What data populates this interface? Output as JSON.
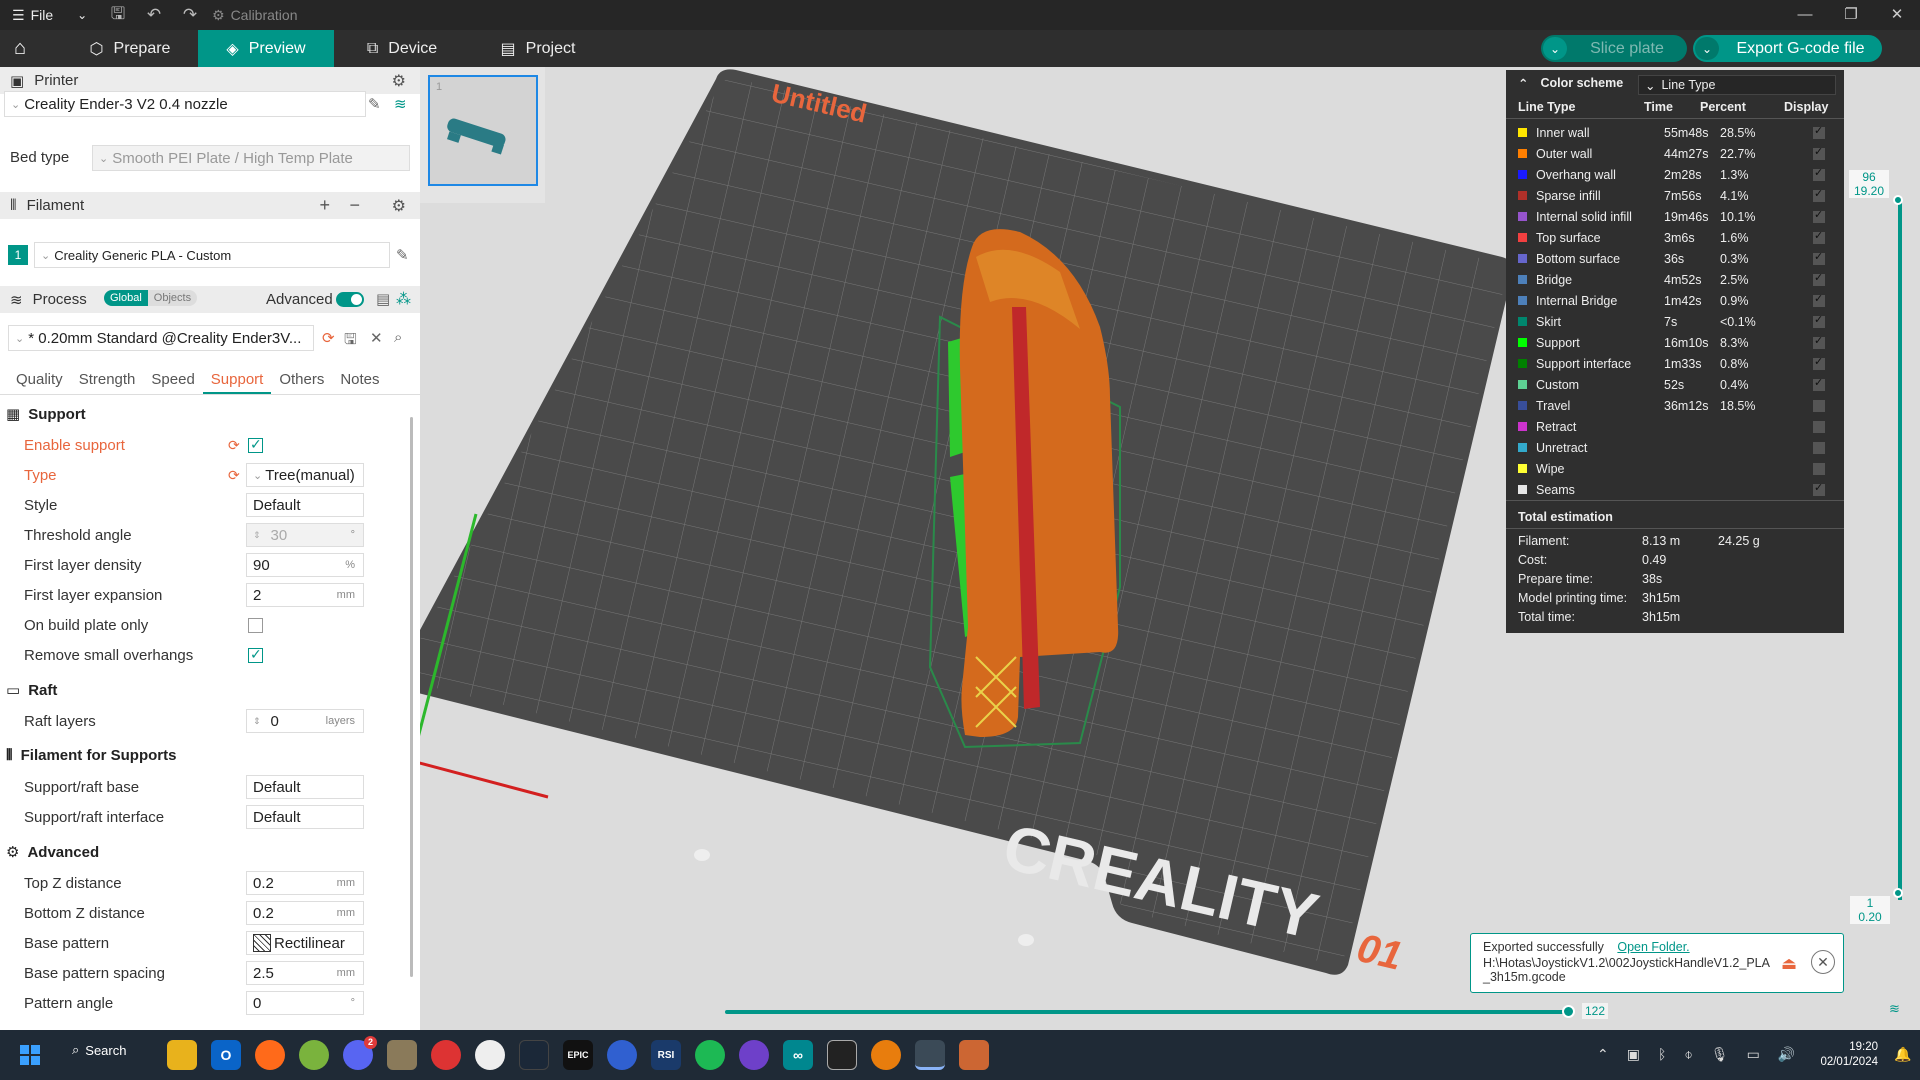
{
  "titlebar": {
    "file_label": "File",
    "doc_title": "Calibration"
  },
  "tabs": {
    "prepare": "Prepare",
    "preview": "Preview",
    "device": "Device",
    "project": "Project",
    "slice_plate": "Slice plate",
    "export_gcode": "Export G-code file"
  },
  "printer": {
    "section_label": "Printer",
    "name": "Creality Ender-3 V2 0.4 nozzle",
    "bed_type_label": "Bed type",
    "bed_type": "Smooth PEI Plate / High Temp Plate"
  },
  "filament": {
    "section_label": "Filament",
    "slot_index": "1",
    "name": "Creality Generic PLA - Custom"
  },
  "process": {
    "section_label": "Process",
    "global_label": "Global",
    "objects_label": "Objects",
    "advanced_label": "Advanced",
    "profile": "* 0.20mm Standard @Creality Ender3V..."
  },
  "subtabs": [
    "Quality",
    "Strength",
    "Speed",
    "Support",
    "Others",
    "Notes"
  ],
  "support_params": {
    "support_title": "Support",
    "enable_support": "Enable support",
    "type_label": "Type",
    "type_value": "Tree(manual)",
    "style_label": "Style",
    "style_value": "Default",
    "threshold_label": "Threshold angle",
    "threshold_value": "30",
    "threshold_unit": "°",
    "first_layer_density_label": "First layer density",
    "first_layer_density_value": "90",
    "first_layer_density_unit": "%",
    "first_layer_expansion_label": "First layer expansion",
    "first_layer_expansion_value": "2",
    "mm": "mm",
    "on_build_plate_label": "On build plate only",
    "remove_small_label": "Remove small overhangs",
    "raft_title": "Raft",
    "raft_layers_label": "Raft layers",
    "raft_layers_value": "0",
    "raft_layers_unit": "layers",
    "filament_supports_title": "Filament for Supports",
    "support_raft_base_label": "Support/raft base",
    "support_raft_base_value": "Default",
    "support_raft_interface_label": "Support/raft interface",
    "support_raft_interface_value": "Default",
    "advanced_title": "Advanced",
    "top_z_label": "Top Z distance",
    "top_z_value": "0.2",
    "bottom_z_label": "Bottom Z distance",
    "bottom_z_value": "0.2",
    "base_pattern_label": "Base pattern",
    "base_pattern_value": "Rectilinear",
    "base_pattern_spacing_label": "Base pattern spacing",
    "base_pattern_spacing_value": "2.5",
    "pattern_angle_label": "Pattern angle",
    "pattern_angle_value": "0",
    "deg": "°"
  },
  "viewport": {
    "plate_name": "Untitled",
    "plate_brand": "CREALITY",
    "plate_number": "01",
    "thumb_index": "1"
  },
  "legend": {
    "color_scheme_label": "Color scheme",
    "color_scheme_value": "Line Type",
    "col_line_type": "Line Type",
    "col_time": "Time",
    "col_percent": "Percent",
    "col_display": "Display",
    "rows": [
      {
        "name": "Inner wall",
        "time": "55m48s",
        "percent": "28.5%",
        "color": "#ffe600",
        "display": true
      },
      {
        "name": "Outer wall",
        "time": "44m27s",
        "percent": "22.7%",
        "color": "#ff7f00",
        "display": true
      },
      {
        "name": "Overhang wall",
        "time": "2m28s",
        "percent": "1.3%",
        "color": "#1a1aff",
        "display": true
      },
      {
        "name": "Sparse infill",
        "time": "7m56s",
        "percent": "4.1%",
        "color": "#b03029",
        "display": true
      },
      {
        "name": "Internal solid infill",
        "time": "19m46s",
        "percent": "10.1%",
        "color": "#9654cc",
        "display": true
      },
      {
        "name": "Top surface",
        "time": "3m6s",
        "percent": "1.6%",
        "color": "#f24040",
        "display": true
      },
      {
        "name": "Bottom surface",
        "time": "36s",
        "percent": "0.3%",
        "color": "#6666cc",
        "display": true
      },
      {
        "name": "Bridge",
        "time": "4m52s",
        "percent": "2.5%",
        "color": "#4d80ba",
        "display": true
      },
      {
        "name": "Internal Bridge",
        "time": "1m42s",
        "percent": "0.9%",
        "color": "#4d80ba",
        "display": true
      },
      {
        "name": "Skirt",
        "time": "7s",
        "percent": "<0.1%",
        "color": "#00876e",
        "display": true
      },
      {
        "name": "Support",
        "time": "16m10s",
        "percent": "8.3%",
        "color": "#00ff00",
        "display": true
      },
      {
        "name": "Support interface",
        "time": "1m33s",
        "percent": "0.8%",
        "color": "#008000",
        "display": true
      },
      {
        "name": "Custom",
        "time": "52s",
        "percent": "0.4%",
        "color": "#5ed194",
        "display": true
      },
      {
        "name": "Travel",
        "time": "36m12s",
        "percent": "18.5%",
        "color": "#384e9a",
        "display": false
      },
      {
        "name": "Retract",
        "time": "",
        "percent": "",
        "color": "#cc33cc",
        "display": false
      },
      {
        "name": "Unretract",
        "time": "",
        "percent": "",
        "color": "#33aacc",
        "display": false
      },
      {
        "name": "Wipe",
        "time": "",
        "percent": "",
        "color": "#ffff33",
        "display": false
      },
      {
        "name": "Seams",
        "time": "",
        "percent": "",
        "color": "#e6e6e6",
        "display": true
      }
    ],
    "total_label": "Total estimation",
    "filament_label": "Filament:",
    "filament_length": "8.13 m",
    "filament_weight": "24.25 g",
    "cost_label": "Cost:",
    "cost_value": "0.49",
    "prepare_label": "Prepare time:",
    "prepare_value": "38s",
    "model_time_label": "Model printing time:",
    "model_time_value": "3h15m",
    "total_time_label": "Total time:",
    "total_time_value": "3h15m"
  },
  "layer_slider": {
    "top_layer": "96",
    "top_height": "19.20",
    "bottom_layer": "1",
    "bottom_height": "0.20"
  },
  "move_slider": {
    "value": "122"
  },
  "notification": {
    "message": "Exported successfully",
    "link": "Open Folder.",
    "path": "H:\\Hotas\\JoystickV1.2\\002JoystickHandleV1.2_PLA_3h15m.gcode"
  },
  "taskbar": {
    "search_label": "Search",
    "time": "19:20",
    "date": "02/01/2024",
    "discord_badge": "2"
  }
}
